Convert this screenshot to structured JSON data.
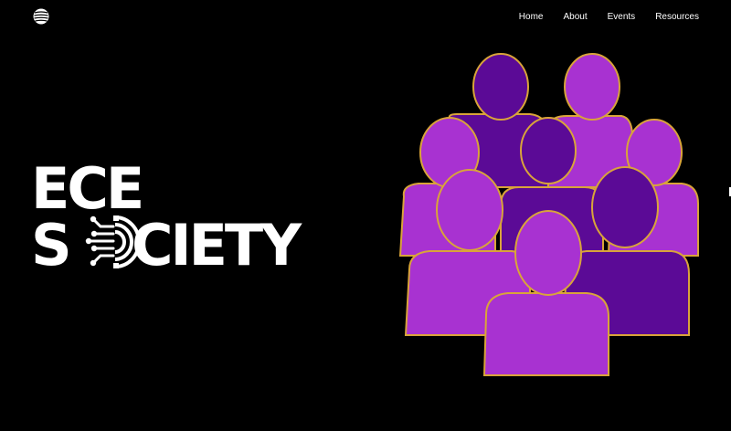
{
  "header": {
    "logo_icon": "circuit-globe-icon",
    "nav": [
      {
        "label": "Home"
      },
      {
        "label": "About"
      },
      {
        "label": "Events"
      },
      {
        "label": "Resources"
      }
    ]
  },
  "hero": {
    "title_line1": "ECE",
    "title_line2_suffix": "CIETY",
    "title_letter_s": "S",
    "logo_o_icon": "circuit-o-icon",
    "illustration": "people-group-illustration"
  },
  "colors": {
    "background": "#000000",
    "text": "#ffffff",
    "purple_light": "#a832d1",
    "purple_dark": "#5b0a96",
    "outline_gold": "#d9a43a"
  }
}
